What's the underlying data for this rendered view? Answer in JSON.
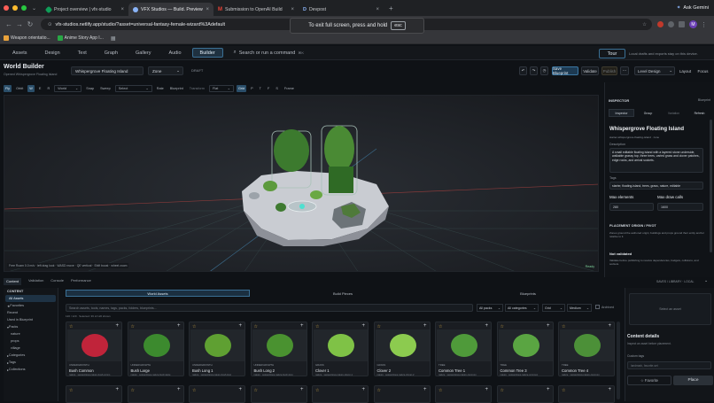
{
  "browser": {
    "tabs": [
      {
        "title": "Project overview | vfx-studio",
        "active": false,
        "color": "#0f9d58"
      },
      {
        "title": "VFX Studios — Build. Preview",
        "active": true,
        "color": "#8ab4f8"
      },
      {
        "title": "Submission to OpenAI Build",
        "active": false,
        "color": "#ea4335"
      },
      {
        "title": "Devpost",
        "active": false,
        "color": "#3c78d8"
      }
    ],
    "url": "vfx-studios.netlify.app/studio/?asset=universal-fantasy-female-wizard%3Adefault",
    "profile_button": "Ask Gemini",
    "profile_letter": "M",
    "bookmarks": [
      "Weapon orientatio...",
      "Anime Story App I..."
    ],
    "fullscreen_toast": {
      "text": "To exit full screen, press and hold",
      "key": "esc"
    }
  },
  "appnav": {
    "items": [
      "Assets",
      "Design",
      "Text",
      "Graph",
      "Gallery",
      "Audio",
      "Builder"
    ],
    "active": "Builder",
    "command_placeholder": "Search or run a command",
    "command_shortcut": "⌘K",
    "tour_label": "Tour",
    "local_note": "Local drafts and exports stay on this device."
  },
  "header": {
    "title": "World Builder",
    "subtitle": "Opened Whispergrove Floating Island",
    "scene_name": "Whispergrove Floating Island",
    "scene_type": "Zone",
    "draft_badge": "DRAFT",
    "buttons": [
      "Save Blueprint",
      "Validate",
      "Publish",
      "Level Design",
      "Layout",
      "Focus"
    ]
  },
  "toolbar": {
    "items": [
      "Fly",
      "Orbit",
      "W",
      "E",
      "R",
      "World",
      "Snap",
      "Sweep"
    ],
    "select_label": "Select",
    "items2": [
      "Rate",
      "Blueprint",
      "Transform"
    ],
    "flat_label": "Flat",
    "items3": [
      "Grid",
      "P",
      "T",
      "F",
      "S",
      "Frame"
    ],
    "inspector_tab": "Inspector"
  },
  "viewport": {
    "status": "Free Roam 0.0 m/s · left drag look · WASD move · QE vertical · Shift boost · wheel zoom",
    "ready": "Ready"
  },
  "inspector": {
    "section_label": "INSPECTOR",
    "blueprint_label": "Blueprint",
    "tabs": [
      "Inspector",
      "Group",
      "Variation",
      "Refresh"
    ],
    "title": "Whispergrove Floating Island",
    "slug": "starter-whispergrove-floating-island · zone",
    "description_label": "Description",
    "description": "A small editable floating island with a layered stone underside, walkable grassy top, three trees, varied grass and clover patches, edge rocks, and arrival sockets.",
    "tags_label": "Tags",
    "tags": "starter, floating-island, trees, grass, nature, editable",
    "max_elements_label": "Max elements",
    "max_elements": "280",
    "max_draw_label": "Max draw calls",
    "max_draw": "1600",
    "origin_label": "PLACEMENT ORIGIN / PIVOT",
    "origin_desc": "Zones ground the authored origin; buildings and props ground their entity anchor relative to it.",
    "validated_label": "Not validated",
    "validated_desc": "Validate before publishing to resolve dependencies, budgets, collisions, and sockets."
  },
  "bottom": {
    "tabs": [
      "Content",
      "Validation",
      "Console",
      "Performance"
    ],
    "saves_label": "SAVES / LIBRARY · LOCAL",
    "left_panel_title": "CONTENT",
    "left_items": [
      "All Assets",
      "Favorites",
      "Recent",
      "Used in Blueprint",
      "Packs",
      "nature",
      "props",
      "village",
      "Categories",
      "Tags",
      "Collections"
    ],
    "content_tabs": [
      "World Assets",
      "Build Pieces",
      "Blueprints"
    ],
    "search_placeholder": "Search assets, tools, names, tags, packs, folders, blueprints...",
    "filters": [
      "All packs",
      "All categories",
      "Grid",
      "Medium",
      "Archived"
    ],
    "count_text": "120 / 120 · Selected: 36 of 120 shown",
    "cards": [
      {
        "tag": "UNDERGROWTH",
        "name": "Bush Common",
        "desc": "nature · sequentious-nature-bush-comm",
        "color": "#c0243a"
      },
      {
        "tag": "UNDERGROWTH",
        "name": "Bush Large",
        "desc": "nature · sequentious-nature-bush-large",
        "color": "#3c8a2e"
      },
      {
        "tag": "UNDERGROWTH",
        "name": "Bush Long 1",
        "desc": "nature · sequentious-nature-bush-long",
        "color": "#5fa032"
      },
      {
        "tag": "UNDERGROWTH",
        "name": "Bush Long 2",
        "desc": "nature · sequentious-nature-bush-long",
        "color": "#4a9230"
      },
      {
        "tag": "GRASS",
        "name": "Clover 1",
        "desc": "nature · sequentious-nature-clover-1",
        "color": "#7fc246"
      },
      {
        "tag": "GRASS",
        "name": "Clover 2",
        "desc": "nature · sequentious-nature-clover-2",
        "color": "#8ccb4f"
      },
      {
        "tag": "TREE",
        "name": "Common Tree 1",
        "desc": "nature · sequentious-nature-common",
        "color": "#4f9a3a"
      },
      {
        "tag": "TREE",
        "name": "Common Tree 3",
        "desc": "nature · sequentious-nature-common",
        "color": "#5aa542"
      },
      {
        "tag": "TREE",
        "name": "Common Tree 4",
        "desc": "nature · sequentious-nature-common",
        "color": "#4c9038"
      }
    ],
    "right_select": "Select an asset",
    "details_title": "Content details",
    "details_desc": "Inspect an asset before placement.",
    "custom_tags_label": "Custom tags",
    "custom_tags_placeholder": "landmark, favorite-set",
    "favorite_btn": "☆ Favorite",
    "place_btn": "Place"
  }
}
